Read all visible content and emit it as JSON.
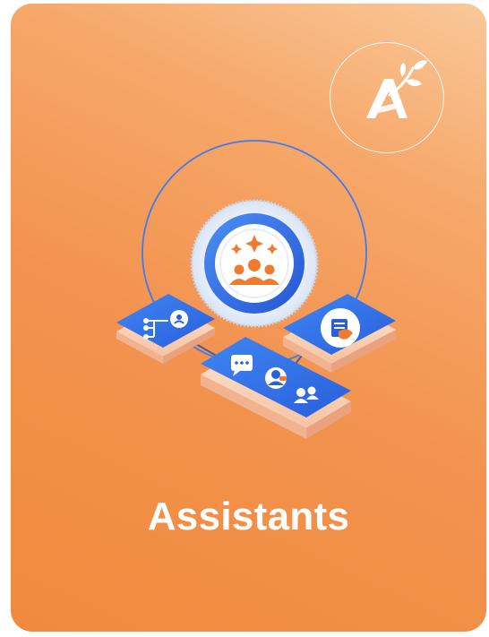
{
  "card": {
    "title": "Assistants",
    "accent_color": "#f18a3c",
    "primary_blue": "#2f6ee8"
  },
  "logo": {
    "icon": "sprout-a-logo-icon"
  },
  "illustration": {
    "center_icon": "team-sparkle-icon",
    "left_tile_icon": "org-network-icon",
    "right_tile_icon": "document-hand-icon",
    "bottom_tile_icons": [
      "chat-icon",
      "support-agent-icon",
      "users-icon"
    ]
  }
}
